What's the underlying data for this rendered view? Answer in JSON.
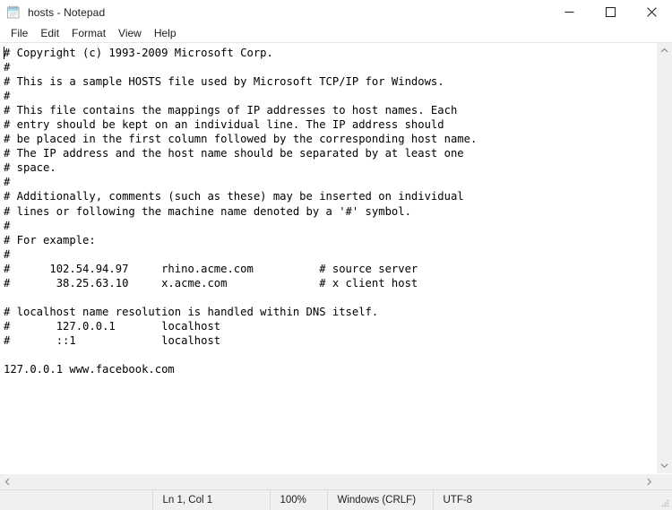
{
  "window": {
    "title": "hosts - Notepad",
    "icon": "notepad-icon",
    "controls": {
      "minimize": "minimize-icon",
      "maximize": "maximize-icon",
      "close": "close-icon"
    }
  },
  "menubar": {
    "items": [
      {
        "label": "File"
      },
      {
        "label": "Edit"
      },
      {
        "label": "Format"
      },
      {
        "label": "View"
      },
      {
        "label": "Help"
      }
    ]
  },
  "editor": {
    "content": "# Copyright (c) 1993-2009 Microsoft Corp.\n#\n# This is a sample HOSTS file used by Microsoft TCP/IP for Windows.\n#\n# This file contains the mappings of IP addresses to host names. Each\n# entry should be kept on an individual line. The IP address should\n# be placed in the first column followed by the corresponding host name.\n# The IP address and the host name should be separated by at least one\n# space.\n#\n# Additionally, comments (such as these) may be inserted on individual\n# lines or following the machine name denoted by a '#' symbol.\n#\n# For example:\n#\n#      102.54.94.97     rhino.acme.com          # source server\n#       38.25.63.10     x.acme.com              # x client host\n\n# localhost name resolution is handled within DNS itself.\n#\t127.0.0.1       localhost\n#\t::1             localhost\n\n127.0.0.1 www.facebook.com",
    "lines": [
      "# Copyright (c) 1993-2009 Microsoft Corp.",
      "#",
      "# This is a sample HOSTS file used by Microsoft TCP/IP for Windows.",
      "#",
      "# This file contains the mappings of IP addresses to host names. Each",
      "# entry should be kept on an individual line. The IP address should",
      "# be placed in the first column followed by the corresponding host name.",
      "# The IP address and the host name should be separated by at least one",
      "# space.",
      "#",
      "# Additionally, comments (such as these) may be inserted on individual",
      "# lines or following the machine name denoted by a '#' symbol.",
      "#",
      "# For example:",
      "#",
      "#      102.54.94.97     rhino.acme.com          # source server",
      "#       38.25.63.10     x.acme.com              # x client host",
      "",
      "# localhost name resolution is handled within DNS itself.",
      "#       127.0.0.1       localhost",
      "#       ::1             localhost",
      "",
      "127.0.0.1 www.facebook.com"
    ]
  },
  "scrollbars": {
    "vertical": {
      "up_arrow": "chevron-up-icon",
      "down_arrow": "chevron-down-icon"
    },
    "horizontal": {
      "left_arrow": "chevron-left-icon",
      "right_arrow": "chevron-right-icon"
    }
  },
  "statusbar": {
    "cursor_position": "Ln 1, Col 1",
    "zoom": "100%",
    "line_ending": "Windows (CRLF)",
    "encoding": "UTF-8"
  },
  "colors": {
    "chrome": "#ffffff",
    "status_bg": "#f0f0f0",
    "text": "#000000",
    "border": "#dcdcdc",
    "close_hover": "#e81123"
  }
}
